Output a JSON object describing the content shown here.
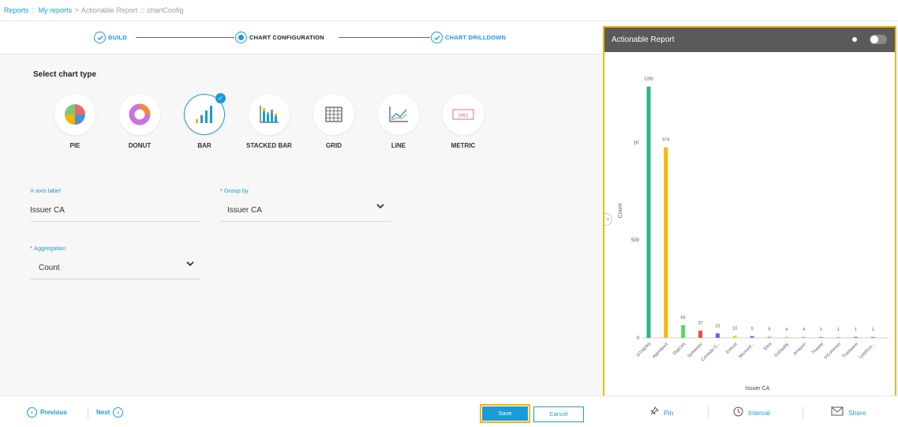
{
  "breadcrumb": {
    "part1": "Reports",
    "part2": "My reports",
    "part3": "Actionable Report",
    "part4": "chartConfig",
    "sep_colon": "::",
    "sep_arrow": ">"
  },
  "stepper": {
    "step1": "BUILD",
    "step2": "CHART CONFIGURATION",
    "step3": "CHART DRILLDOWN"
  },
  "chart_type": {
    "title": "Select chart type",
    "options": [
      {
        "label": "PIE",
        "icon": "pie-chart-icon"
      },
      {
        "label": "DONUT",
        "icon": "donut-chart-icon"
      },
      {
        "label": "BAR",
        "icon": "bar-chart-icon",
        "selected": true
      },
      {
        "label": "STACKED BAR",
        "icon": "stacked-bar-icon"
      },
      {
        "label": "GRID",
        "icon": "grid-icon"
      },
      {
        "label": "LINE",
        "icon": "line-chart-icon"
      },
      {
        "label": "METRIC",
        "icon": "metric-icon",
        "sample": "2461"
      }
    ],
    "check": "✓"
  },
  "form": {
    "xaxis_label": "X-axis label",
    "xaxis_value": "Issuer CA",
    "groupby_label": "Group by",
    "groupby_value": "Issuer CA",
    "aggregation_label": "Aggregation",
    "aggregation_value": "Count",
    "required_mark": "*",
    "chevron": "⌄"
  },
  "footer": {
    "previous": "Previous",
    "next": "Next",
    "save": "Save",
    "cancel": "Cancel",
    "pin": "Pin",
    "interval": "Interval",
    "share": "Share",
    "prev_icon": "‹",
    "next_icon": "›"
  },
  "preview": {
    "title": "Actionable Report",
    "collapse_icon": "‹"
  },
  "colors": {
    "accent": "#1a9bd7",
    "highlight": "#f5b400",
    "header": "#5a5a5a"
  },
  "chart_data": {
    "type": "bar",
    "xlabel": "Issuer CA",
    "ylabel": "Count",
    "ylim": [
      0,
      1300
    ],
    "yticks": [
      0,
      500,
      1000
    ],
    "ytick_labels": [
      "0",
      "500",
      "1K"
    ],
    "categories": [
      "OTHERS",
      "AppViewX",
      "DigiCert",
      "Symantec",
      "Comodo C...",
      "Entrust",
      "Microsof...",
      "Eltra",
      "GoDaddy",
      "Amazon",
      "Thawte",
      "InCommon",
      "Trustwave",
      "LetsEncr..."
    ],
    "values": [
      1285,
      974,
      65,
      37,
      23,
      10,
      9,
      6,
      4,
      4,
      1,
      1,
      1,
      1
    ],
    "colors": [
      "#2bb58e",
      "#f7b500",
      "#5cd65c",
      "#f24b3c",
      "#4a6cf7",
      "#f7d200",
      "#b05cd6",
      "#9ccc65",
      "#ffb74d",
      "#ef9a9a",
      "#64b5f6",
      "#aed581",
      "#ba68c8",
      "#4db6ac"
    ],
    "grid": false,
    "legend": "none"
  }
}
